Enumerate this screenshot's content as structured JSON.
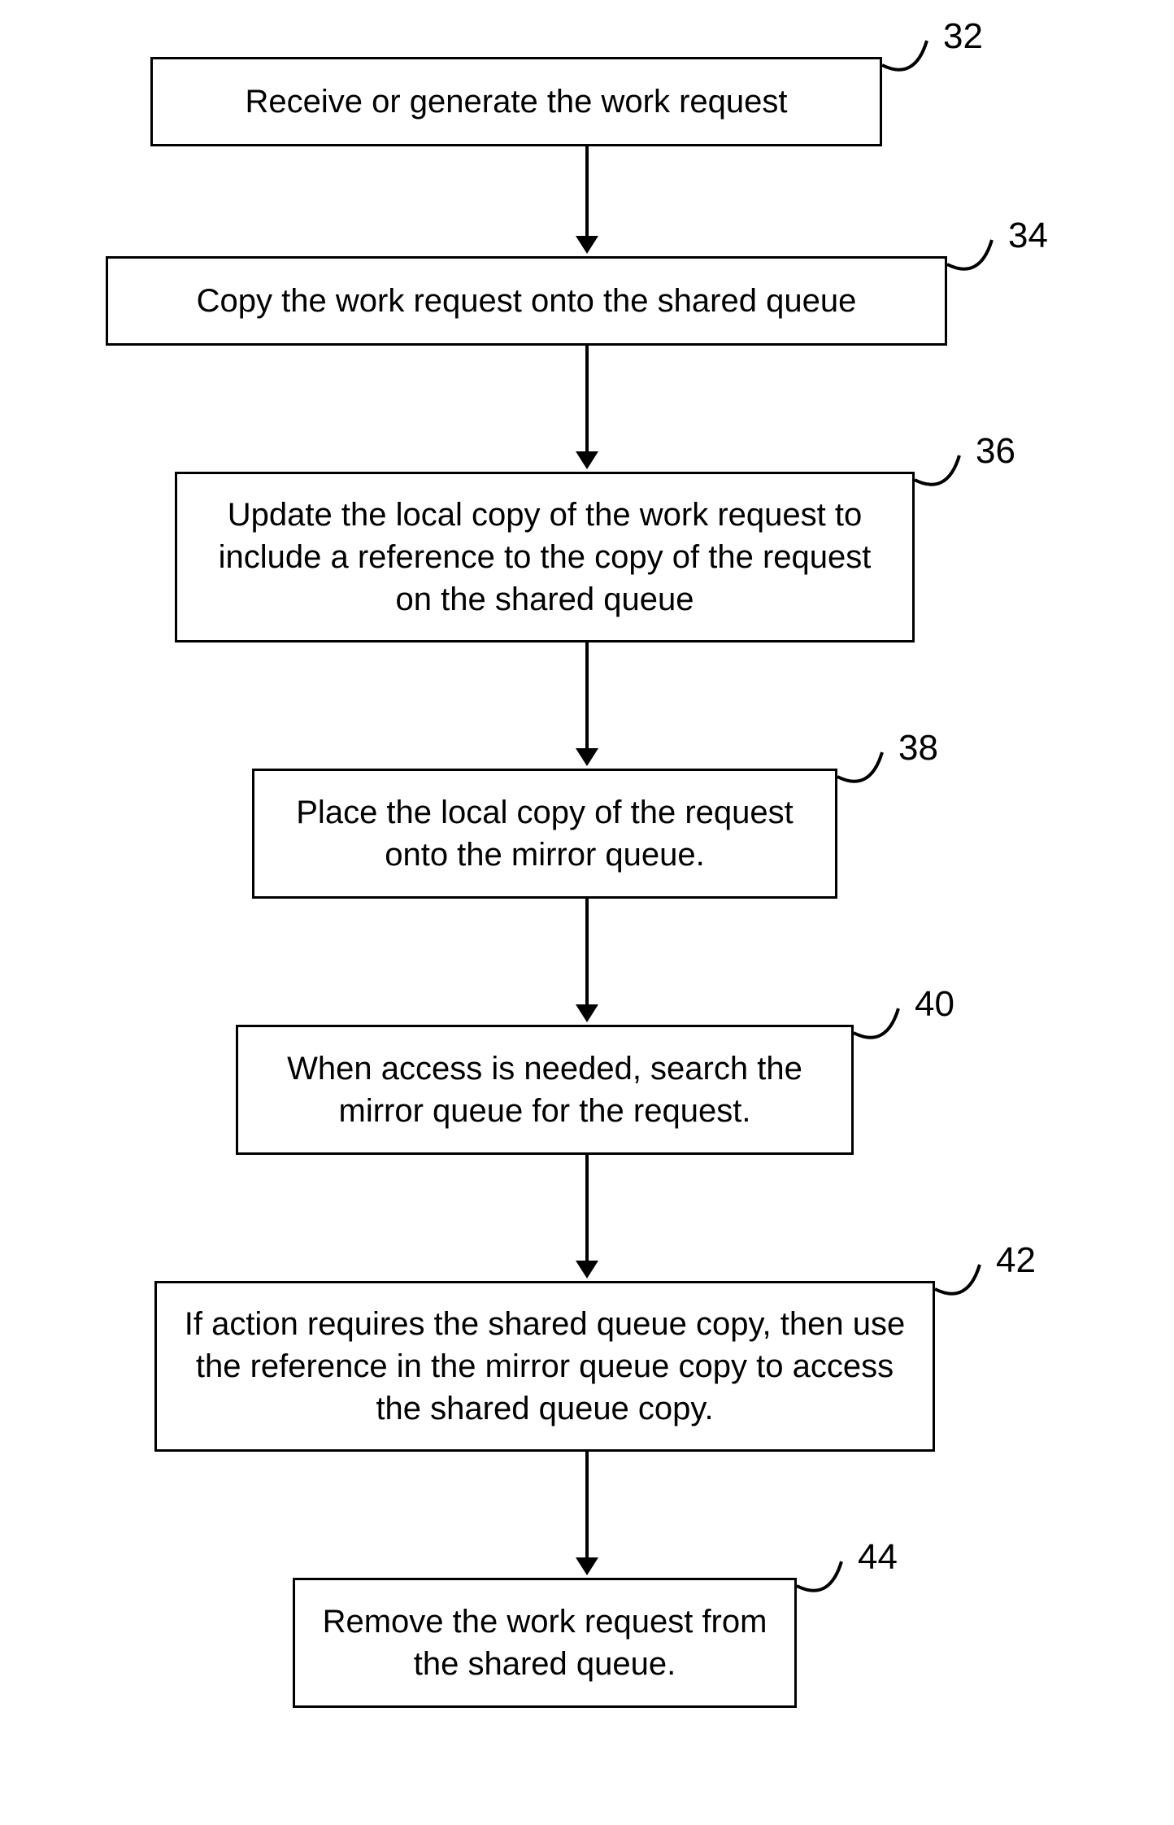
{
  "chart_data": {
    "type": "flowchart",
    "direction": "top-to-bottom",
    "nodes": [
      {
        "id": "32",
        "text": "Receive or generate the work request"
      },
      {
        "id": "34",
        "text": "Copy the work request onto the shared queue"
      },
      {
        "id": "36",
        "text": "Update the local copy of the work request to include a reference to the copy of the request on the shared queue"
      },
      {
        "id": "38",
        "text": "Place the local copy of the request onto the mirror queue."
      },
      {
        "id": "40",
        "text": "When access is needed, search the mirror queue for the request."
      },
      {
        "id": "42",
        "text": "If action requires the shared queue copy, then use the reference in the mirror queue copy to access the shared queue copy."
      },
      {
        "id": "44",
        "text": "Remove the work request from the shared queue."
      }
    ],
    "edges": [
      {
        "from": "32",
        "to": "34"
      },
      {
        "from": "34",
        "to": "36"
      },
      {
        "from": "36",
        "to": "38"
      },
      {
        "from": "38",
        "to": "40"
      },
      {
        "from": "40",
        "to": "42"
      },
      {
        "from": "42",
        "to": "44"
      }
    ]
  },
  "labels": {
    "n32": "32",
    "n34": "34",
    "n36": "36",
    "n38": "38",
    "n40": "40",
    "n42": "42",
    "n44": "44"
  }
}
